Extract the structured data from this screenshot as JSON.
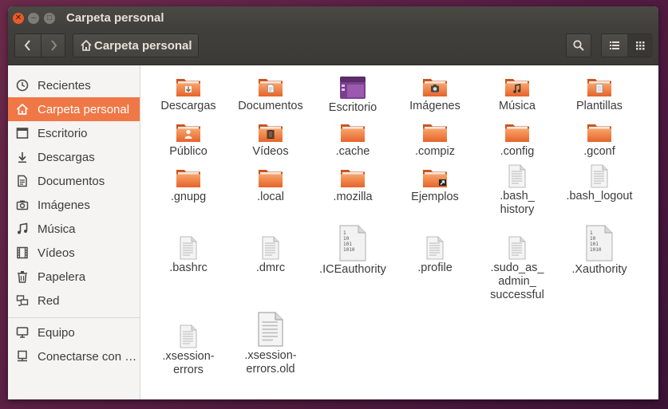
{
  "window": {
    "title": "Carpeta personal"
  },
  "toolbar": {
    "path_label": "Carpeta personal"
  },
  "sidebar": {
    "items": [
      {
        "label": "Recientes",
        "icon": "clock-icon"
      },
      {
        "label": "Carpeta personal",
        "icon": "home-icon"
      },
      {
        "label": "Escritorio",
        "icon": "desktop-icon"
      },
      {
        "label": "Descargas",
        "icon": "download-icon"
      },
      {
        "label": "Documentos",
        "icon": "document-icon"
      },
      {
        "label": "Imágenes",
        "icon": "camera-icon"
      },
      {
        "label": "Música",
        "icon": "music-icon"
      },
      {
        "label": "Vídeos",
        "icon": "film-icon"
      },
      {
        "label": "Papelera",
        "icon": "trash-icon"
      },
      {
        "label": "Red",
        "icon": "network-icon"
      },
      {
        "label": "Equipo",
        "icon": "computer-icon"
      },
      {
        "label": "Conectarse con …",
        "icon": "server-icon"
      }
    ]
  },
  "files": [
    {
      "label": "Descargas",
      "type": "folder",
      "emblem": "download"
    },
    {
      "label": "Documentos",
      "type": "folder",
      "emblem": "document"
    },
    {
      "label": "Escritorio",
      "type": "desktop"
    },
    {
      "label": "Imágenes",
      "type": "folder",
      "emblem": "camera"
    },
    {
      "label": "Música",
      "type": "folder",
      "emblem": "music"
    },
    {
      "label": "Plantillas",
      "type": "folder",
      "emblem": "template"
    },
    {
      "label": "Público",
      "type": "folder",
      "emblem": "person"
    },
    {
      "label": "Vídeos",
      "type": "folder",
      "emblem": "film"
    },
    {
      "label": ".cache",
      "type": "folder"
    },
    {
      "label": ".compiz",
      "type": "folder"
    },
    {
      "label": ".config",
      "type": "folder"
    },
    {
      "label": ".gconf",
      "type": "folder"
    },
    {
      "label": ".gnupg",
      "type": "folder"
    },
    {
      "label": ".local",
      "type": "folder"
    },
    {
      "label": ".mozilla",
      "type": "folder"
    },
    {
      "label": "Ejemplos",
      "type": "folder",
      "emblem": "link"
    },
    {
      "label": ".bash_\nhistory",
      "type": "text"
    },
    {
      "label": ".bash_logout",
      "type": "text"
    },
    {
      "label": ".bashrc",
      "type": "text"
    },
    {
      "label": ".dmrc",
      "type": "text"
    },
    {
      "label": ".ICEauthority",
      "type": "binary"
    },
    {
      "label": ".profile",
      "type": "text"
    },
    {
      "label": ".sudo_as_\nadmin_\nsuccessful",
      "type": "text"
    },
    {
      "label": ".Xauthority",
      "type": "binary"
    },
    {
      "label": ".xsession-\nerrors",
      "type": "text"
    },
    {
      "label": ".xsession-\nerrors.old",
      "type": "textlarge"
    }
  ],
  "binary_icon_text": [
    "1",
    "10",
    "101",
    "1010"
  ],
  "colors": {
    "accent": "#f07746",
    "folder": "#f08a3c",
    "titlebar": "#403f3b"
  }
}
